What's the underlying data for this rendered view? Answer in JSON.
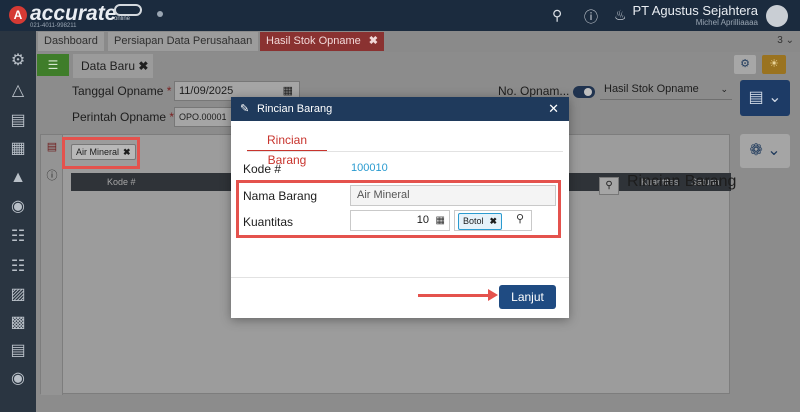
{
  "topbar": {
    "brand": "accurate",
    "brand_sub": "online",
    "contact": "021-4011-998211",
    "company": "PT Agustus Sejahtera",
    "username": "Michel Aprilliaaaa"
  },
  "tabs": [
    {
      "label": "Dashboard"
    },
    {
      "label": "Persiapan Data Perusahaan"
    },
    {
      "label": "Hasil Stok Opname",
      "close": "✖"
    }
  ],
  "tab_counter": "3 ⌄",
  "form": {
    "subtab_label": "Data Baru",
    "subtab_close": "✖",
    "tanggal_label": "Tanggal Opname",
    "tanggal_value": "11/09/2025",
    "perintah_label": "Perintah Opname",
    "perintah_value": "OPO.00001",
    "no_label": "No. Opnam...",
    "select_value": "Hasil Stok Opname",
    "required_mark": "*"
  },
  "panel": {
    "chip_label": "Air Mineral",
    "chip_close": "✖",
    "col_kode": "Kode #",
    "col_kuantitas": "Kuantitas",
    "col_satuan": "Satuan",
    "rincian_title": "Rincian Barang"
  },
  "modal": {
    "title": "Rincian Barang",
    "close": "✕",
    "tab": "Rincian Barang",
    "kode_label": "Kode #",
    "kode_value": "100010",
    "nama_label": "Nama Barang",
    "nama_value": "Air Mineral",
    "qty_label": "Kuantitas",
    "qty_value": "10",
    "unit_label": "Botol",
    "unit_close": "✖",
    "button": "Lanjut"
  },
  "colors": {
    "header": "#1f3a5c",
    "accent_red": "#c8342d",
    "highlight": "#e4524d",
    "link": "#2a9bd0",
    "button": "#1f4b82"
  }
}
